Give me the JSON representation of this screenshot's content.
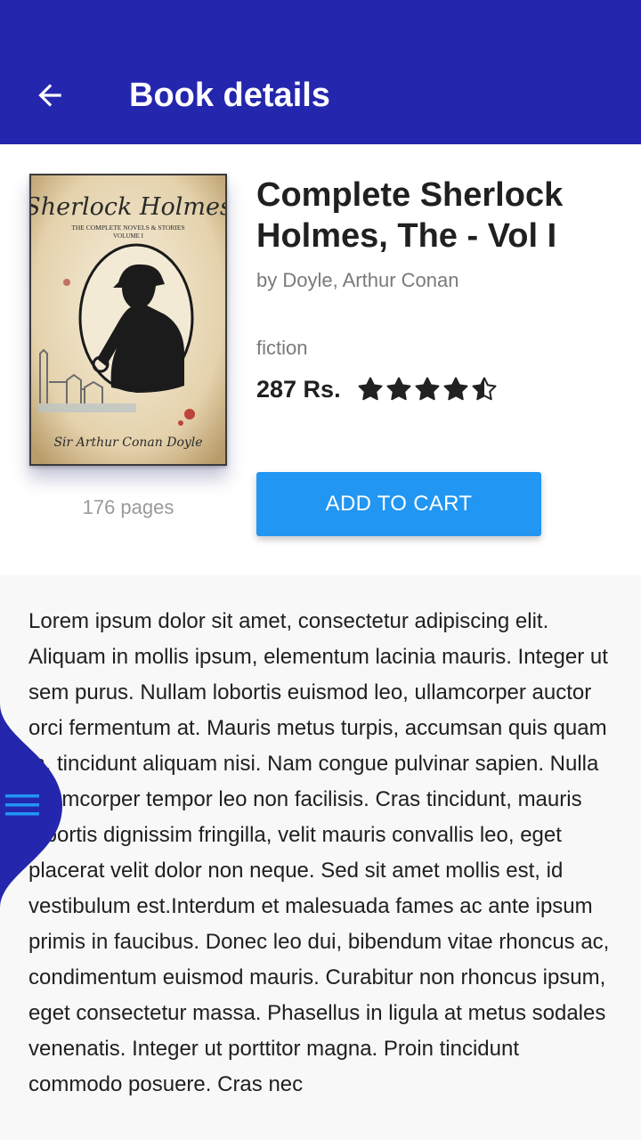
{
  "app_bar": {
    "title": "Book details",
    "back_icon": "arrow-left-icon",
    "background_color": "#2427ad"
  },
  "book": {
    "cover_title": "Sherlock Holmes",
    "cover_subtitle_1": "THE COMPLETE NOVELS & STORIES",
    "cover_subtitle_2": "VOLUME I",
    "cover_author": "Sir Arthur Conan Doyle",
    "pages": "176 pages",
    "title": "Complete Sherlock Holmes, The - Vol I",
    "author": "by Doyle, Arthur Conan",
    "genre": "fiction",
    "price": "287 Rs.",
    "rating": 4.5,
    "rating_max": 5
  },
  "actions": {
    "add_to_cart_label": "ADD TO CART",
    "button_color": "#2196f3"
  },
  "description": "Lorem ipsum dolor sit amet, consectetur adipiscing elit. Aliquam in mollis ipsum, elementum lacinia mauris. Integer ut sem purus. Nullam lobortis euismod leo, ullamcorper auctor orci fermentum at. Mauris metus turpis, accumsan quis quam in, tincidunt aliquam nisi. Nam congue pulvinar sapien. Nulla ullamcorper tempor leo non facilisis. Cras tincidunt, mauris lobortis dignissim fringilla, velit mauris convallis leo, eget placerat velit dolor non neque. Sed sit amet mollis est, id vestibulum est.Interdum et malesuada fames ac ante ipsum primis in faucibus. Donec leo dui, bibendum vitae rhoncus ac, condimentum euismod mauris. Curabitur non rhoncus ipsum, eget consectetur massa. Phasellus in ligula at metus sodales venenatis. Integer ut porttitor magna. Proin tincidunt commodo posuere. Cras nec",
  "side_menu": {
    "icon": "hamburger-menu-icon",
    "tab_color": "#2427ad",
    "icon_color": "#2196f3"
  }
}
